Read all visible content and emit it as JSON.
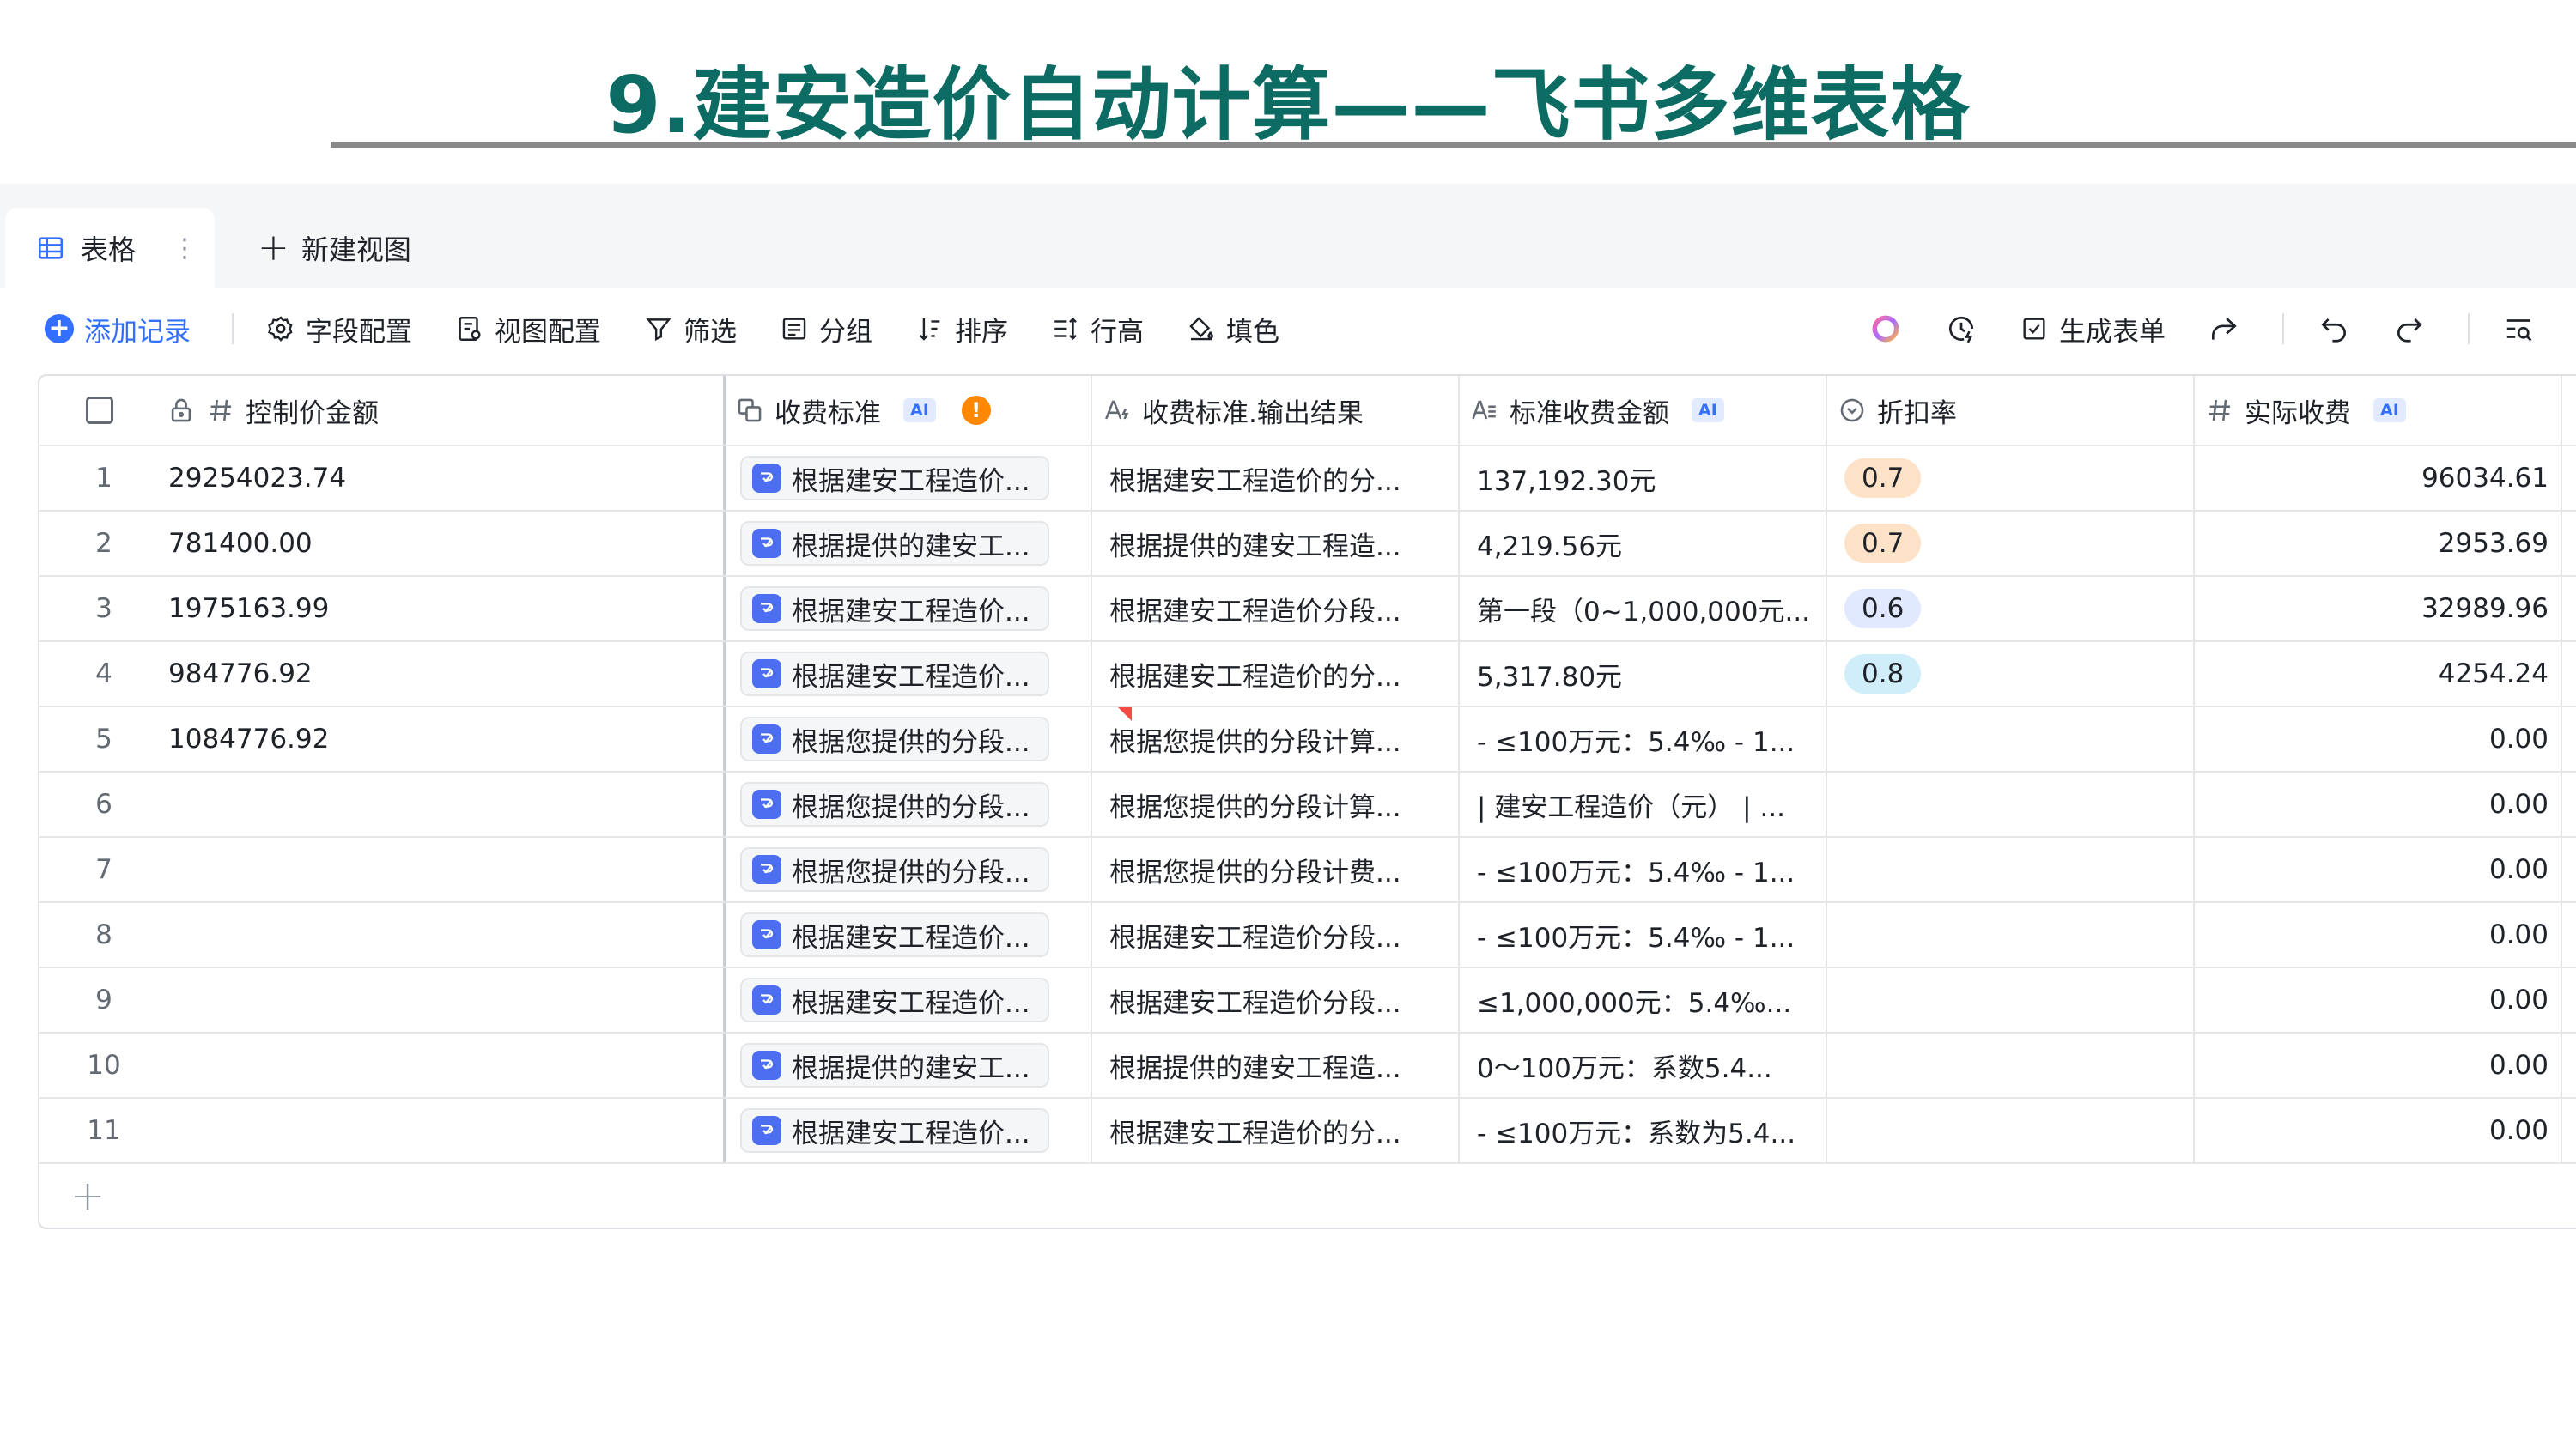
{
  "slide": {
    "title": "9.建安造价自动计算——飞书多维表格"
  },
  "tabs": {
    "active_label": "表格",
    "new_view_label": "新建视图"
  },
  "toolbar": {
    "add_record": "添加记录",
    "field_config": "字段配置",
    "view_config": "视图配置",
    "filter": "筛选",
    "group": "分组",
    "sort": "排序",
    "row_height": "行高",
    "fill_color": "填色",
    "generate_form": "生成表单"
  },
  "columns": [
    {
      "label": "控制价金额",
      "icon": "number-lock-icon",
      "ai": false
    },
    {
      "label": "收费标准",
      "icon": "ai-field-icon",
      "ai": true,
      "warning": "!"
    },
    {
      "label": "收费标准.输出结果",
      "icon": "text-output-icon",
      "ai": false
    },
    {
      "label": "标准收费金额",
      "icon": "text-lines-icon",
      "ai": true
    },
    {
      "label": "折扣率",
      "icon": "single-select-icon",
      "ai": false
    },
    {
      "label": "实际收费",
      "icon": "number-hash-icon",
      "ai": true
    }
  ],
  "ai_badge": "AI",
  "colors": {
    "accent": "#3370ff",
    "title": "#0c6b62",
    "tag_07_bg": "#fde2c7",
    "tag_06_bg": "#e0e9ff",
    "tag_08_bg": "#cfeefa"
  },
  "rows": [
    {
      "n": "1",
      "amount": "29254023.74",
      "standard": "根据建安工程造价...",
      "output": "根据建安工程造价的分...",
      "fee": "137,192.30元",
      "discount": "0.7",
      "actual": "96034.61"
    },
    {
      "n": "2",
      "amount": "781400.00",
      "standard": "根据提供的建安工...",
      "output": "根据提供的建安工程造...",
      "fee": "4,219.56元",
      "discount": "0.7",
      "actual": "2953.69"
    },
    {
      "n": "3",
      "amount": "1975163.99",
      "standard": "根据建安工程造价...",
      "output": "根据建安工程造价分段...",
      "fee": "第一段（0~1,000,000元...",
      "discount": "0.6",
      "actual": "32989.96"
    },
    {
      "n": "4",
      "amount": "984776.92",
      "standard": "根据建安工程造价...",
      "output": "根据建安工程造价的分...",
      "fee": "5,317.80元",
      "discount": "0.8",
      "actual": "4254.24"
    },
    {
      "n": "5",
      "amount": "1084776.92",
      "standard": "根据您提供的分段...",
      "output": "根据您提供的分段计算...",
      "fee": "- ≤100万元：5.4‰ - 1...",
      "discount": "",
      "actual": "0.00"
    },
    {
      "n": "6",
      "amount": "",
      "standard": "根据您提供的分段...",
      "output": "根据您提供的分段计算...",
      "fee": "| 建安工程造价（元） | ...",
      "discount": "",
      "actual": "0.00"
    },
    {
      "n": "7",
      "amount": "",
      "standard": "根据您提供的分段...",
      "output": "根据您提供的分段计费...",
      "fee": "- ≤100万元：5.4‰ - 1...",
      "discount": "",
      "actual": "0.00"
    },
    {
      "n": "8",
      "amount": "",
      "standard": "根据建安工程造价...",
      "output": "根据建安工程造价分段...",
      "fee": "- ≤100万元：5.4‰ - 1...",
      "discount": "",
      "actual": "0.00"
    },
    {
      "n": "9",
      "amount": "",
      "standard": "根据建安工程造价...",
      "output": "根据建安工程造价分段...",
      "fee": "≤1,000,000元：5.4‰...",
      "discount": "",
      "actual": "0.00"
    },
    {
      "n": "10",
      "amount": "",
      "standard": "根据提供的建安工...",
      "output": "根据提供的建安工程造...",
      "fee": "0～100万元：系数5.4...",
      "discount": "",
      "actual": "0.00"
    },
    {
      "n": "11",
      "amount": "",
      "standard": "根据建安工程造价...",
      "output": "根据建安工程造价的分...",
      "fee": "- ≤100万元：系数为5.4...",
      "discount": "",
      "actual": "0.00"
    }
  ]
}
